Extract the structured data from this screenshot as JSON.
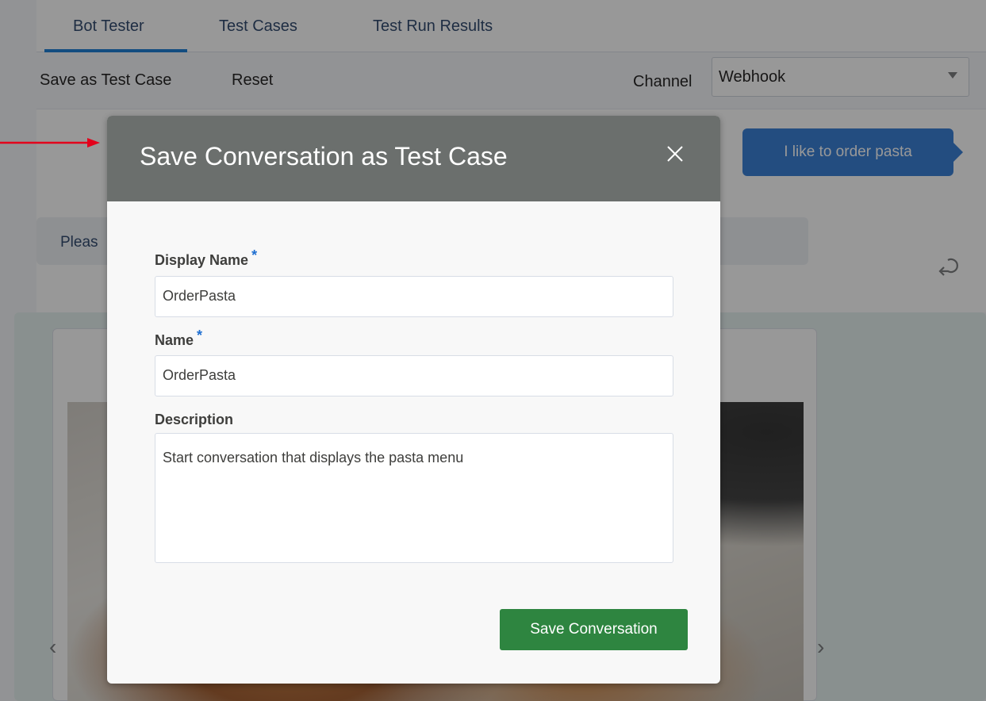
{
  "tabs": [
    {
      "label": "Bot Tester",
      "active": true
    },
    {
      "label": "Test Cases",
      "active": false
    },
    {
      "label": "Test Run Results",
      "active": false
    }
  ],
  "toolbar": {
    "save_as_test_case_label": "Save as Test Case",
    "reset_label": "Reset",
    "channel_label": "Channel",
    "channel_value": "Webhook"
  },
  "chat": {
    "user_message": "I like to order pasta",
    "bot_message_visible": "Pleas"
  },
  "modal": {
    "title": "Save Conversation as Test Case",
    "display_name_label": "Display Name",
    "display_name_value": "OrderPasta",
    "name_label": "Name",
    "name_value": "OrderPasta",
    "description_label": "Description",
    "description_value": "Start conversation that displays the pasta menu",
    "required_marker": "*",
    "save_button_label": "Save Conversation"
  },
  "colors": {
    "accent_blue": "#1f6fd1",
    "tab_underline": "#0070d2",
    "modal_header": "#6b6f6d",
    "save_button": "#2e8540",
    "annotation_arrow": "#e3001b"
  },
  "icons": {
    "close": "close-icon",
    "undo": "undo-icon",
    "select_caret": "chevron-down-icon",
    "carousel_prev": "chevron-left-icon",
    "carousel_next": "chevron-right-icon"
  }
}
